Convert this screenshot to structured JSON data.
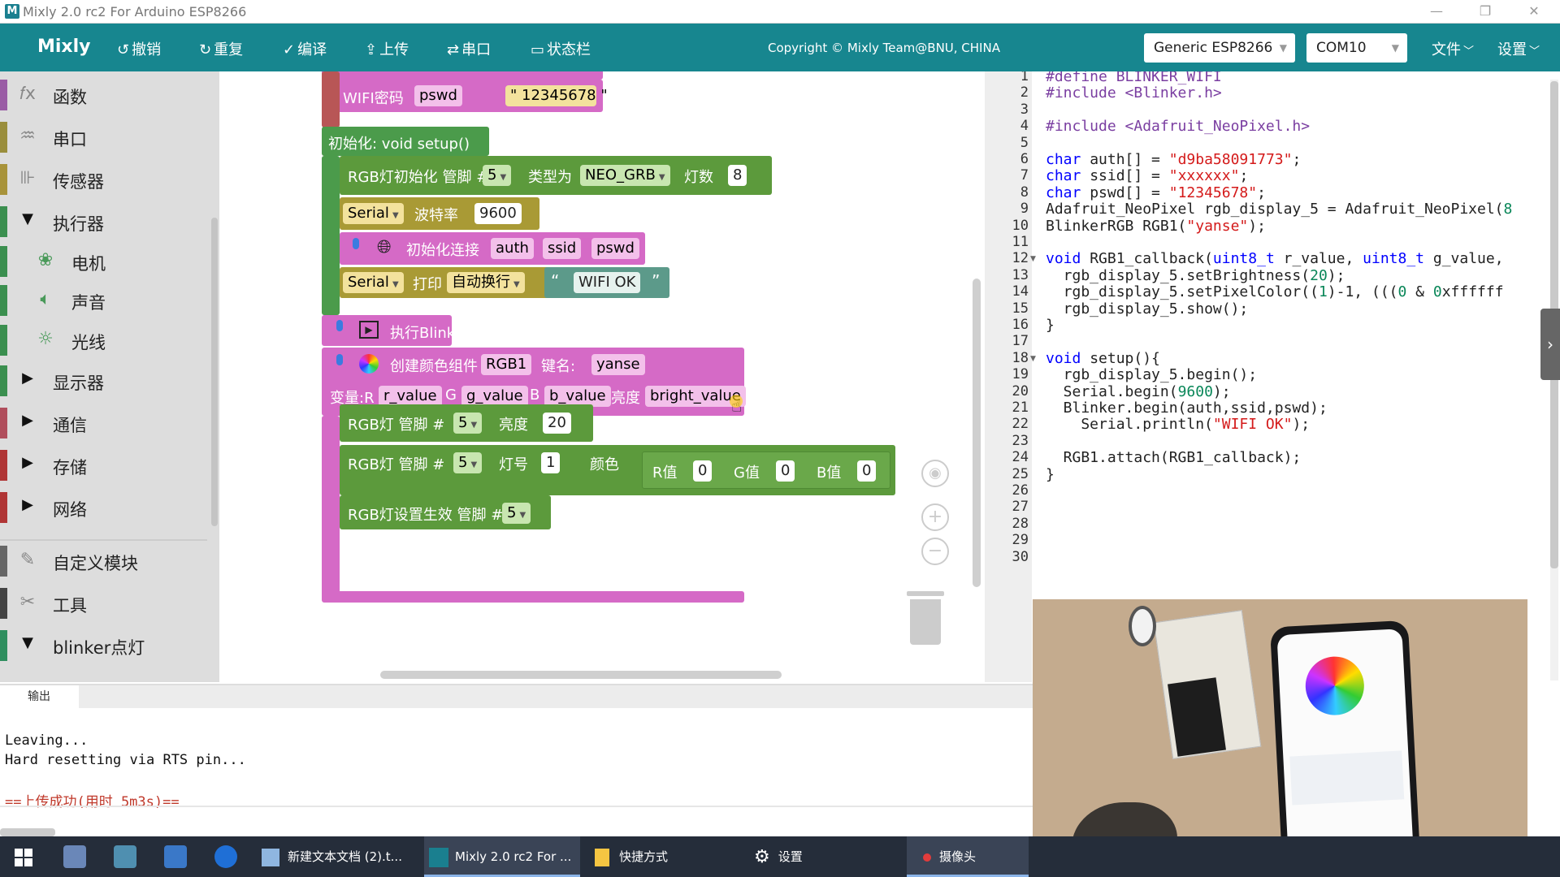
{
  "window": {
    "title": "Mixly 2.0 rc2 For Arduino ESP8266",
    "minimize": "—",
    "maximize": "❐",
    "close": "✕"
  },
  "toolbar": {
    "brand": "Mixly",
    "undo": "撤销",
    "redo": "重复",
    "compile": "编译",
    "upload": "上传",
    "serial": "串口",
    "statusbar": "状态栏",
    "copyright": "Copyright © Mixly Team@BNU, CHINA",
    "board": "Generic ESP8266",
    "port": "COM10",
    "file_menu": "文件",
    "settings_menu": "设置"
  },
  "sidebar": {
    "items": [
      {
        "label": "函数",
        "icon": "function-icon",
        "color": "#9a5ca5"
      },
      {
        "label": "串口",
        "icon": "serial-icon",
        "color": "#9a8e3c"
      },
      {
        "label": "传感器",
        "icon": "sensor-icon",
        "color": "#a8933a"
      },
      {
        "label": "执行器",
        "icon": "actuator-icon",
        "color": "#3b8f4f"
      },
      {
        "label": "电机",
        "icon": "motor-icon",
        "color": "#3b8f4f"
      },
      {
        "label": "声音",
        "icon": "sound-icon",
        "color": "#3b8f4f"
      },
      {
        "label": "光线",
        "icon": "light-icon",
        "color": "#3b8f4f"
      },
      {
        "label": "显示器",
        "icon": "display-icon",
        "color": "#3b8f4f"
      },
      {
        "label": "通信",
        "icon": "comm-icon",
        "color": "#b04e5c"
      },
      {
        "label": "存储",
        "icon": "storage-icon",
        "color": "#b03535"
      },
      {
        "label": "网络",
        "icon": "network-icon",
        "color": "#b03535"
      },
      {
        "label": "自定义模块",
        "icon": "custom-icon",
        "color": "#666666"
      },
      {
        "label": "工具",
        "icon": "tools-icon",
        "color": "#444444"
      },
      {
        "label": "blinker点灯",
        "icon": "expand-icon",
        "color": "#2f8f5f"
      }
    ]
  },
  "blocks": {
    "wifi_pwd_label": "WIFI密码",
    "wifi_pwd_var": "pswd",
    "wifi_pwd_value": "12345678",
    "setup_label": "初始化: void setup()",
    "rgb_init_label": "RGB灯初始化  管脚 #",
    "rgb_init_pin": "5",
    "rgb_init_type_label": "类型为",
    "rgb_init_type": "NEO_GRB",
    "rgb_init_count_label": "灯数",
    "rgb_init_count": "8",
    "serial_label": "Serial",
    "baud_label": "波特率",
    "baud_value": "9600",
    "init_conn_label": "初始化连接",
    "auth": "auth",
    "ssid": "ssid",
    "pswd": "pswd",
    "print_label": "打印",
    "print_mode": "自动换行",
    "print_text": "WIFI OK",
    "run_blinker": "执行Blinker",
    "create_color": "创建颜色组件",
    "color_name": "RGB1",
    "key_label": "键名:",
    "key_name": "yanse",
    "var_label": "变量:R",
    "r_value": "r_value",
    "g_label": "G",
    "g_value": "g_value",
    "b_label": "B",
    "b_value": "b_value",
    "bright_label": "亮度",
    "bright_value": "bright_value",
    "rgb_bright_label": "RGB灯  管脚 #",
    "rgb_bright_pin": "5",
    "rgb_bright_text": "亮度",
    "rgb_bright_val": "20",
    "rgb_color_label": "RGB灯  管脚 #",
    "rgb_color_pin": "5",
    "rgb_color_num_label": "灯号",
    "rgb_color_num": "1",
    "rgb_color_text": "颜色",
    "r_label": "R值",
    "r_val": "0",
    "g_label2": "G值",
    "g_val": "0",
    "b_label2": "B值",
    "b_val": "0",
    "rgb_show_label": "RGB灯设置生效  管脚 #",
    "rgb_show_pin": "5"
  },
  "code": {
    "lines": [
      "#define BLINKER_WIFI",
      "#include <Blinker.h>",
      "",
      "#include <Adafruit_NeoPixel.h>",
      "",
      "char auth[] = \"d9ba58091773\";",
      "char ssid[] = \"xxxxxx\";",
      "char pswd[] = \"12345678\";",
      "Adafruit_NeoPixel rgb_display_5 = Adafruit_NeoPixel(8",
      "BlinkerRGB RGB1(\"yanse\");",
      "",
      "void RGB1_callback(uint8_t r_value, uint8_t g_value,",
      "  rgb_display_5.setBrightness(20);",
      "  rgb_display_5.setPixelColor((1)-1, (((0 & 0xffffff",
      "  rgb_display_5.show();",
      "}",
      "",
      "void setup(){",
      "  rgb_display_5.begin();",
      "  Serial.begin(9600);",
      "  Blinker.begin(auth,ssid,pswd);",
      "    Serial.println(\"WIFI OK\");",
      "",
      "  RGB1.attach(RGB1_callback);",
      "}",
      "",
      "",
      "",
      "",
      ""
    ]
  },
  "output": {
    "tab": "输出",
    "lines": [
      "Leaving...",
      "Hard resetting via RTS pin...",
      "",
      "==上传成功(用时 5m3s)=="
    ]
  },
  "taskbar": {
    "items": [
      {
        "label": "新建文本文档 (2).t..."
      },
      {
        "label": "Mixly 2.0 rc2 For ..."
      },
      {
        "label": "快捷方式"
      },
      {
        "label": "设置"
      },
      {
        "label": "摄像头"
      }
    ]
  },
  "colors": {
    "toolbar": "#17868f",
    "blinker_block": "#d56ac6",
    "rgb_block": "#5c9a3c",
    "serial_block": "#a99a35",
    "setup_block": "#3f8f3f"
  }
}
